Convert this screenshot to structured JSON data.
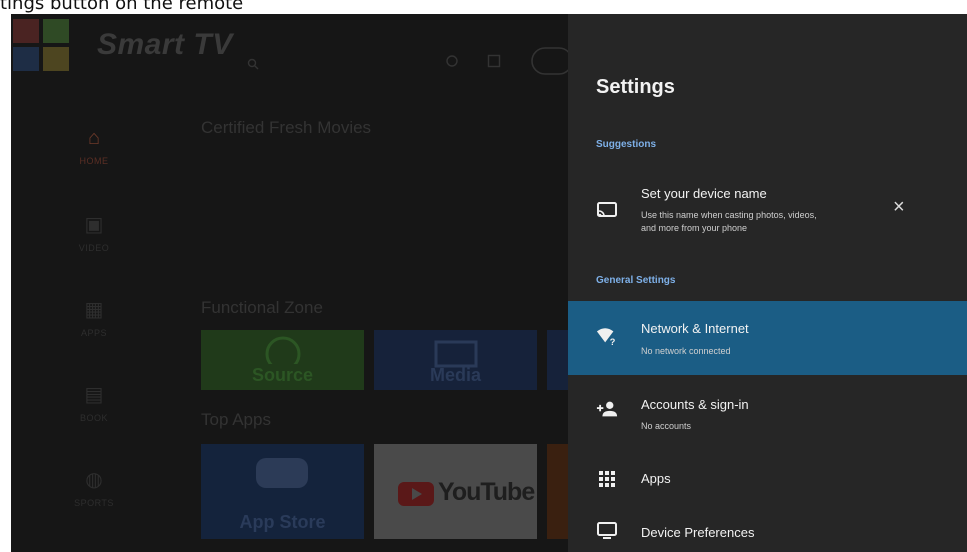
{
  "caption": "tings button on the remote",
  "home": {
    "brand": "Smart TV",
    "sidebar": [
      {
        "icon": "home-icon",
        "label": "HOME"
      },
      {
        "icon": "video-icon",
        "label": "VIDEO"
      },
      {
        "icon": "apps-icon",
        "label": "APPS"
      },
      {
        "icon": "book-icon",
        "label": "BOOK"
      },
      {
        "icon": "sports-icon",
        "label": "SPORTS"
      }
    ],
    "sections": {
      "movies": "Certified Fresh Movies",
      "functional": "Functional Zone",
      "top_apps": "Top Apps"
    },
    "tiles": {
      "source": "Source",
      "media": "Media",
      "app_store": "App Store",
      "youtube": "YouTube"
    }
  },
  "settings": {
    "title": "Settings",
    "suggestions_header": "Suggestions",
    "suggestion": {
      "title": "Set your device name",
      "subtitle_line1": "Use this name when casting photos, videos,",
      "subtitle_line2": "and more from your phone",
      "close_glyph": "×"
    },
    "general_header": "General Settings",
    "items": [
      {
        "title": "Network & Internet",
        "subtitle": "No network connected",
        "icon": "wifi-question-icon",
        "selected": true
      },
      {
        "title": "Accounts & sign-in",
        "subtitle": "No accounts",
        "icon": "add-person-icon"
      },
      {
        "title": "Apps",
        "subtitle": "",
        "icon": "apps-grid-icon"
      },
      {
        "title": "Device Preferences",
        "subtitle": "",
        "icon": "monitor-icon"
      }
    ]
  },
  "colors": {
    "panel_bg": "#262626",
    "selected_bg": "#1b5d85",
    "section_header": "#7eb0e8"
  }
}
